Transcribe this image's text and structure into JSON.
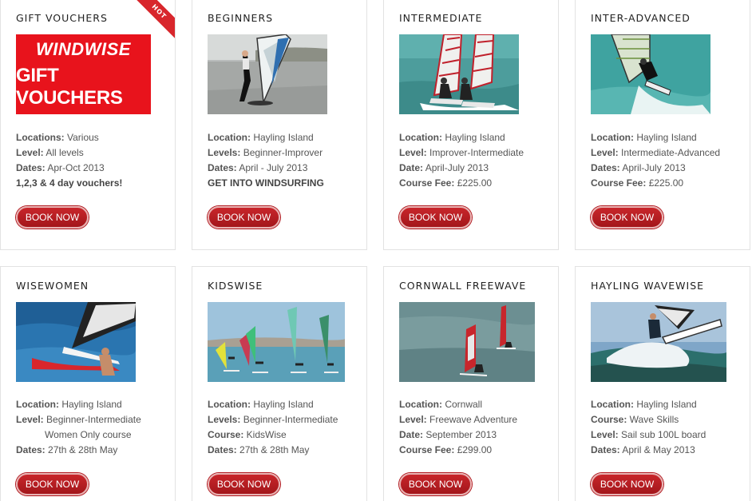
{
  "courses": [
    {
      "title": "GIFT VOUCHERS",
      "badge": "HOT",
      "image_text_line1": "WINDWISE",
      "image_text_line2": "GIFT VOUCHERS",
      "lines": [
        {
          "label": "Locations:",
          "value": " Various"
        },
        {
          "label": "Level:",
          "value": " All levels"
        },
        {
          "label": "Dates:",
          "value": " Apr-Oct 2013"
        },
        {
          "strong": "1,2,3 & 4 day vouchers!"
        }
      ],
      "button": "BOOK NOW"
    },
    {
      "title": "BEGINNERS",
      "lines": [
        {
          "label": "Location:",
          "value": " Hayling Island"
        },
        {
          "label": "Levels:",
          "value": " Beginner-Improver"
        },
        {
          "label": "Dates:",
          "value": " April - July 2013"
        },
        {
          "strong": "GET INTO WINDSURFING"
        }
      ],
      "button": "BOOK NOW"
    },
    {
      "title": "INTERMEDIATE",
      "lines": [
        {
          "label": "Location:",
          "value": " Hayling Island"
        },
        {
          "label": "Level:",
          "value": " Improver-Intermediate"
        },
        {
          "label": "Date:",
          "value": " April-July 2013"
        },
        {
          "label": "Course Fee:",
          "value": " £225.00"
        }
      ],
      "button": "BOOK NOW"
    },
    {
      "title": "INTER-ADVANCED",
      "lines": [
        {
          "label": "Location:",
          "value": " Hayling Island"
        },
        {
          "label": "Level:",
          "value": " Intermediate-Advanced"
        },
        {
          "label": "Dates:",
          "value": " April-July 2013"
        },
        {
          "label": "Course Fee:",
          "value": " £225.00"
        }
      ],
      "button": "BOOK NOW"
    },
    {
      "title": "WISEWOMEN",
      "lines": [
        {
          "label": "Location:",
          "value": " Hayling Island"
        },
        {
          "label": "Level:",
          "value": " Beginner-Intermediate"
        },
        {
          "indent": "Women Only course"
        },
        {
          "label": "Dates:",
          "value": " 27th & 28th May"
        }
      ],
      "button": "BOOK NOW"
    },
    {
      "title": "KIDSWISE",
      "lines": [
        {
          "label": "Location:",
          "value": " Hayling Island"
        },
        {
          "label": "Levels:",
          "value": " Beginner-Intermediate"
        },
        {
          "label": "Course:",
          "value": " KidsWise"
        },
        {
          "label": "Dates:",
          "value": " 27th & 28th May"
        }
      ],
      "button": "BOOK NOW"
    },
    {
      "title": "CORNWALL FREEWAVE",
      "lines": [
        {
          "label": "Location:",
          "value": " Cornwall"
        },
        {
          "label": "Level:",
          "value": " Freewave Adventure"
        },
        {
          "label": "Date:",
          "value": " September 2013"
        },
        {
          "label": "Course Fee:",
          "value": " £299.00"
        }
      ],
      "button": "BOOK NOW"
    },
    {
      "title": "HAYLING WAVEWISE",
      "lines": [
        {
          "label": "Location:",
          "value": " Hayling Island"
        },
        {
          "label": "Course:",
          "value": " Wave Skills"
        },
        {
          "label": "Level:",
          "value": " Sail sub 100L board"
        },
        {
          "label": "Dates:",
          "value": " April & May 2013"
        }
      ],
      "button": "BOOK NOW"
    }
  ],
  "colors": {
    "button_red": "#b11a20",
    "voucher_red": "#e8131c",
    "hot_badge": "#d8262c"
  }
}
